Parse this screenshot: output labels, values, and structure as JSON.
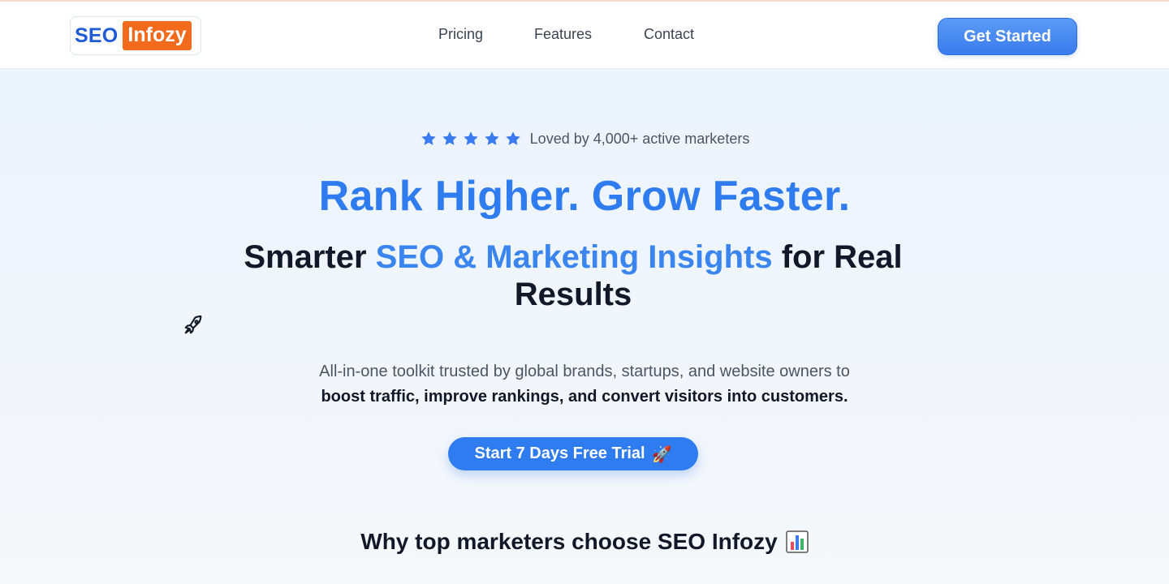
{
  "brand": {
    "seo": "SEO",
    "infozy": "Infozy"
  },
  "nav": {
    "pricing": "Pricing",
    "features": "Features",
    "contact": "Contact"
  },
  "header": {
    "cta": "Get Started"
  },
  "rating": {
    "stars": 5,
    "text": "Loved by 4,000+ active marketers"
  },
  "hero": {
    "title": "Rank Higher. Grow Faster.",
    "subtitle_pre": "Smarter ",
    "subtitle_highlight": "SEO & Marketing Insights",
    "subtitle_post": " for Real Results",
    "desc_line1": "All-in-one toolkit trusted by global brands, startups, and website owners to",
    "desc_line2": "boost traffic, improve rankings, and convert visitors into customers.",
    "cta": "Start 7 Days Free Trial",
    "cta_emoji": "🚀"
  },
  "section": {
    "why": "Why top marketers choose SEO Infozy"
  },
  "icons": {
    "star": "star-icon",
    "rocket": "rocket-icon",
    "chart": "bar-chart-icon"
  },
  "colors": {
    "brand_blue": "#2f7bf0",
    "brand_orange": "#f26a1b",
    "star": "#3a7bef"
  }
}
